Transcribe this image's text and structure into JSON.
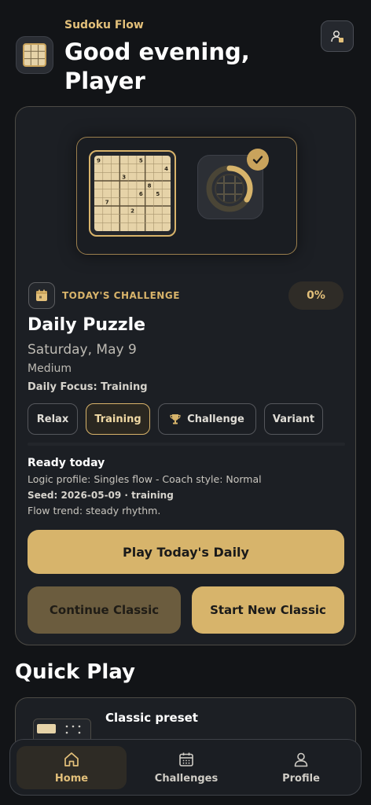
{
  "header": {
    "app_name": "Sudoku Flow",
    "greeting": "Good evening, Player"
  },
  "daily": {
    "challenge_label": "TODAY'S CHALLENGE",
    "progress": "0%",
    "title": "Daily Puzzle",
    "date": "Saturday, May 9",
    "difficulty": "Medium",
    "focus": "Daily Focus: Training",
    "board_digits": [
      "9",
      "5",
      "4",
      "3",
      "8",
      "6",
      "5",
      "7",
      "2"
    ],
    "modes": [
      {
        "label": "Relax",
        "active": false
      },
      {
        "label": "Training",
        "active": true
      },
      {
        "label": "Challenge",
        "active": false,
        "icon": "trophy-icon"
      },
      {
        "label": "Variant",
        "active": false
      }
    ],
    "ready_title": "Ready today",
    "logic_profile": "Logic profile: Singles flow - Coach style: Normal",
    "seed": "Seed: 2026-05-09 · training",
    "flow_trend": "Flow trend: steady rhythm.",
    "play_label": "Play Today's Daily",
    "continue_label": "Continue Classic",
    "new_label": "Start New Classic"
  },
  "quick_play": {
    "title": "Quick Play",
    "first_item": "Classic preset"
  },
  "nav": {
    "items": [
      {
        "label": "Home",
        "icon": "home-icon",
        "active": true
      },
      {
        "label": "Challenges",
        "icon": "calendar-icon",
        "active": false
      },
      {
        "label": "Profile",
        "icon": "person-icon",
        "active": false
      }
    ]
  },
  "colors": {
    "accent": "#d7b46b",
    "background": "#121417",
    "card": "#1c1f24"
  }
}
